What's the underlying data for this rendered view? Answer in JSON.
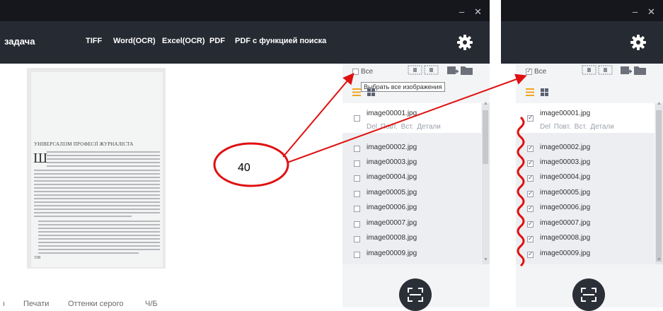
{
  "window_controls": {
    "minimize": "–",
    "close": "✕"
  },
  "left_window": {
    "task_label": "задача",
    "toolbar": [
      "TIFF",
      "Word(OCR)",
      "Excel(OCR)",
      "PDF",
      "PDF с функцией поиска"
    ],
    "document": {
      "title": "УНІВЕРСАЛІЗМ ПРОФЕСІЇ ЖУРНАЛІСТА",
      "initial": "Ш",
      "page_number": "158"
    },
    "bottom_tabs": [
      "Печати",
      "Оттенки серого",
      "Ч/Б"
    ]
  },
  "panel_left": {
    "select_all_label": "Все",
    "select_all_checked": false,
    "tooltip": "Выбрать все изображения",
    "items": [
      {
        "name": "image00001.jpg",
        "checked": false
      },
      {
        "name": "image00002.jpg",
        "checked": false
      },
      {
        "name": "image00003.jpg",
        "checked": false
      },
      {
        "name": "image00004.jpg",
        "checked": false
      },
      {
        "name": "image00005.jpg",
        "checked": false
      },
      {
        "name": "image00006.jpg",
        "checked": false
      },
      {
        "name": "image00007.jpg",
        "checked": false
      },
      {
        "name": "image00008.jpg",
        "checked": false
      },
      {
        "name": "image00009.jpg",
        "checked": false
      }
    ],
    "row_actions": "Del Повт. Вст. Детали"
  },
  "panel_right": {
    "select_all_label": "Все",
    "select_all_checked": true,
    "items": [
      {
        "name": "image00001.jpg",
        "checked": true
      },
      {
        "name": "image00002.jpg",
        "checked": true
      },
      {
        "name": "image00003.jpg",
        "checked": true
      },
      {
        "name": "image00004.jpg",
        "checked": true
      },
      {
        "name": "image00005.jpg",
        "checked": true
      },
      {
        "name": "image00006.jpg",
        "checked": true
      },
      {
        "name": "image00007.jpg",
        "checked": true
      },
      {
        "name": "image00008.jpg",
        "checked": true
      },
      {
        "name": "image00009.jpg",
        "checked": true
      }
    ],
    "row_actions": "Del Повт. Вст. Детали"
  },
  "annotation": {
    "label": "40"
  },
  "colors": {
    "titlebar": "#15171c",
    "toolbar": "#262a33",
    "panel_bg": "#f3f4f6",
    "list_icon_orange": "#f0a520",
    "annotation_red": "#e01010"
  }
}
